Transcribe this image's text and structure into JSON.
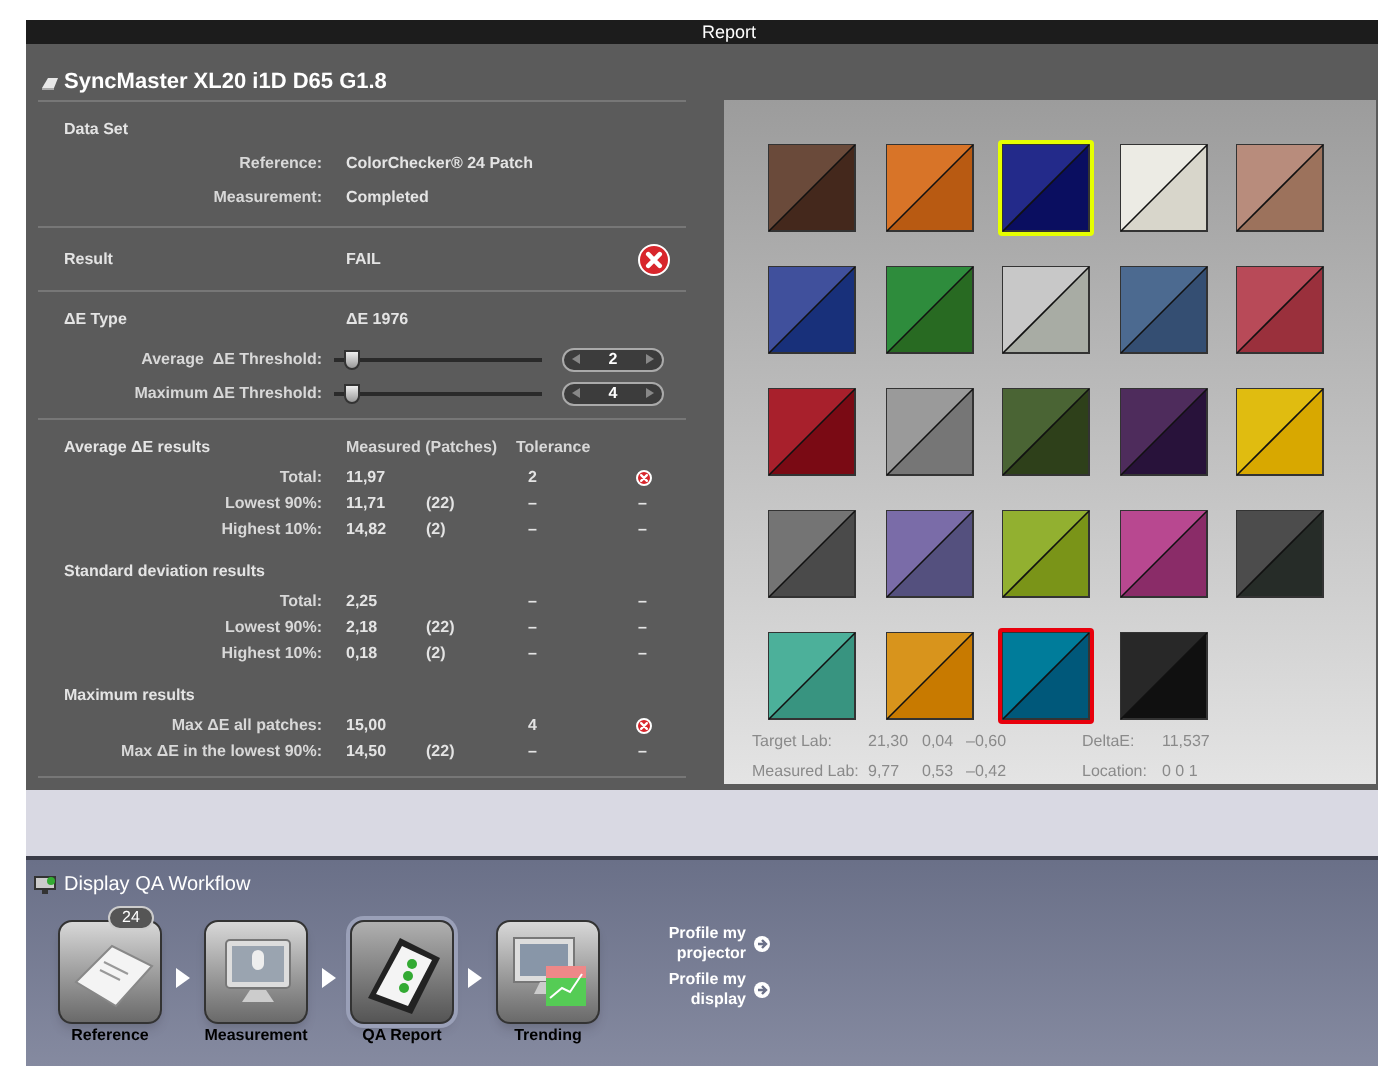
{
  "window": {
    "title": "Report"
  },
  "display_name": "SyncMaster XL20 i1D D65 G1.8",
  "data_set": {
    "heading": "Data Set",
    "rows": [
      {
        "label": "Reference:",
        "value": "ColorChecker® 24 Patch"
      },
      {
        "label": "Measurement:",
        "value": "Completed"
      }
    ]
  },
  "result": {
    "label": "Result",
    "value": "FAIL",
    "passed": false
  },
  "delta_e_type": {
    "label": "ΔE Type",
    "value": "ΔE 1976"
  },
  "thresholds": [
    {
      "label": "Average  ΔE Threshold:",
      "level": 0.05,
      "value": "2"
    },
    {
      "label": "Maximum ΔE Threshold:",
      "level": 0.05,
      "value": "4"
    }
  ],
  "results": {
    "columns": [
      "Measured (Patches)",
      "Tolerance"
    ],
    "sections": [
      {
        "title": "Average ΔE results",
        "rows": [
          {
            "label": "Total:",
            "measured": "11,97",
            "tolerance": "2",
            "kind": "fail"
          },
          {
            "label": "Lowest 90%:",
            "measured": "11,71",
            "patches": "(22)",
            "tolerance": "–",
            "kind": "text",
            "status_text": "–"
          },
          {
            "label": "Highest 10%:",
            "measured": "14,82",
            "patches": "(2)",
            "tolerance": "–",
            "kind": "text",
            "status_text": "–"
          }
        ]
      },
      {
        "title": "Standard deviation results",
        "rows": [
          {
            "label": "Total:",
            "measured": "2,25",
            "tolerance": "–",
            "kind": "text",
            "status_text": "–"
          },
          {
            "label": "Lowest 90%:",
            "measured": "2,18",
            "patches": "(22)",
            "tolerance": "–",
            "kind": "text",
            "status_text": "–"
          },
          {
            "label": "Highest 10%:",
            "measured": "0,18",
            "patches": "(2)",
            "tolerance": "–",
            "kind": "text",
            "status_text": "–"
          }
        ]
      },
      {
        "title": "Maximum results",
        "rows": [
          {
            "label": "Max ΔE all patches:",
            "measured": "15,00",
            "tolerance": "4",
            "kind": "fail"
          },
          {
            "label": "Max ΔE in the lowest 90%:",
            "measured": "14,50",
            "patches": "(22)",
            "tolerance": "–",
            "kind": "text",
            "status_text": "–"
          }
        ]
      }
    ]
  },
  "patches": [
    {
      "target": {
        "color": "#6a4a3a"
      },
      "measured": {
        "color": "#44281c"
      },
      "highlighted": false,
      "selected": false
    },
    {
      "target": {
        "color": "#d87428"
      },
      "measured": {
        "color": "#b85a12"
      },
      "highlighted": false,
      "selected": false
    },
    {
      "target": {
        "color": "#232a8a"
      },
      "measured": {
        "color": "#0a0e60"
      },
      "highlighted": true,
      "selected": false
    },
    {
      "target": {
        "color": "#ecebe4"
      },
      "measured": {
        "color": "#d8d6cb"
      },
      "highlighted": false,
      "selected": false
    },
    {
      "target": {
        "color": "#b88c7c"
      },
      "measured": {
        "color": "#9c725c"
      },
      "highlighted": false,
      "selected": false
    },
    {
      "target": {
        "color": "#40509c"
      },
      "measured": {
        "color": "#18307a"
      },
      "highlighted": false,
      "selected": false
    },
    {
      "target": {
        "color": "#2e8c3c"
      },
      "measured": {
        "color": "#286a22"
      },
      "highlighted": false,
      "selected": false
    },
    {
      "target": {
        "color": "#c8c8c8"
      },
      "measured": {
        "color": "#a8aca4"
      },
      "highlighted": false,
      "selected": false
    },
    {
      "target": {
        "color": "#4c6a90"
      },
      "measured": {
        "color": "#344e72"
      },
      "highlighted": false,
      "selected": false
    },
    {
      "target": {
        "color": "#b84a58"
      },
      "measured": {
        "color": "#9a303c"
      },
      "highlighted": false,
      "selected": false
    },
    {
      "target": {
        "color": "#a8202c"
      },
      "measured": {
        "color": "#7a0a14"
      },
      "highlighted": false,
      "selected": false
    },
    {
      "target": {
        "color": "#9a9a9a"
      },
      "measured": {
        "color": "#767676"
      },
      "highlighted": false,
      "selected": false
    },
    {
      "target": {
        "color": "#4a6434"
      },
      "measured": {
        "color": "#2e401a"
      },
      "highlighted": false,
      "selected": false
    },
    {
      "target": {
        "color": "#4e2c5c"
      },
      "measured": {
        "color": "#28123a"
      },
      "highlighted": false,
      "selected": false
    },
    {
      "target": {
        "color": "#e0bc10"
      },
      "measured": {
        "color": "#d8a800"
      },
      "highlighted": false,
      "selected": false
    },
    {
      "target": {
        "color": "#747474"
      },
      "measured": {
        "color": "#4a4a4a"
      },
      "highlighted": false,
      "selected": false
    },
    {
      "target": {
        "color": "#7a6ca8"
      },
      "measured": {
        "color": "#54507e"
      },
      "highlighted": false,
      "selected": false
    },
    {
      "target": {
        "color": "#92b030"
      },
      "measured": {
        "color": "#7a9418"
      },
      "highlighted": false,
      "selected": false
    },
    {
      "target": {
        "color": "#b84890"
      },
      "measured": {
        "color": "#8a2c68"
      },
      "highlighted": false,
      "selected": false
    },
    {
      "target": {
        "color": "#4c4c4c"
      },
      "measured": {
        "color": "#262c28"
      },
      "highlighted": false,
      "selected": false
    },
    {
      "target": {
        "color": "#4cb09a"
      },
      "measured": {
        "color": "#389480"
      },
      "highlighted": false,
      "selected": false
    },
    {
      "target": {
        "color": "#d8941c"
      },
      "measured": {
        "color": "#c87a00"
      },
      "highlighted": false,
      "selected": false
    },
    {
      "target": {
        "color": "#007c9a"
      },
      "measured": {
        "color": "#00587a"
      },
      "highlighted": false,
      "selected": true
    },
    {
      "target": {
        "color": "#282828"
      },
      "measured": {
        "color": "#101010"
      },
      "highlighted": false,
      "selected": false
    }
  ],
  "patch_info": {
    "target_lab": {
      "label": "Target Lab:",
      "values": [
        "21,30",
        "0,04",
        "–0,60"
      ]
    },
    "measured_lab": {
      "label": "Measured Lab:",
      "values": [
        "9,77",
        "0,53",
        "–0,42"
      ]
    },
    "delta_e": {
      "label": "DeltaE:",
      "value": "11,537"
    },
    "location": {
      "label": "Location:",
      "value": "0 0 1"
    }
  },
  "workflow": {
    "title": "Display QA Workflow",
    "steps": [
      {
        "kind": "document",
        "label": "Reference",
        "badge": "24",
        "selected": false
      },
      {
        "kind": "monitor",
        "label": "Measurement",
        "selected": false
      },
      {
        "kind": "clipboard",
        "label": "QA Report",
        "selected": true
      },
      {
        "kind": "chart",
        "label": "Trending",
        "selected": false
      }
    ],
    "links": [
      "Profile my projector",
      "Profile my display"
    ]
  }
}
